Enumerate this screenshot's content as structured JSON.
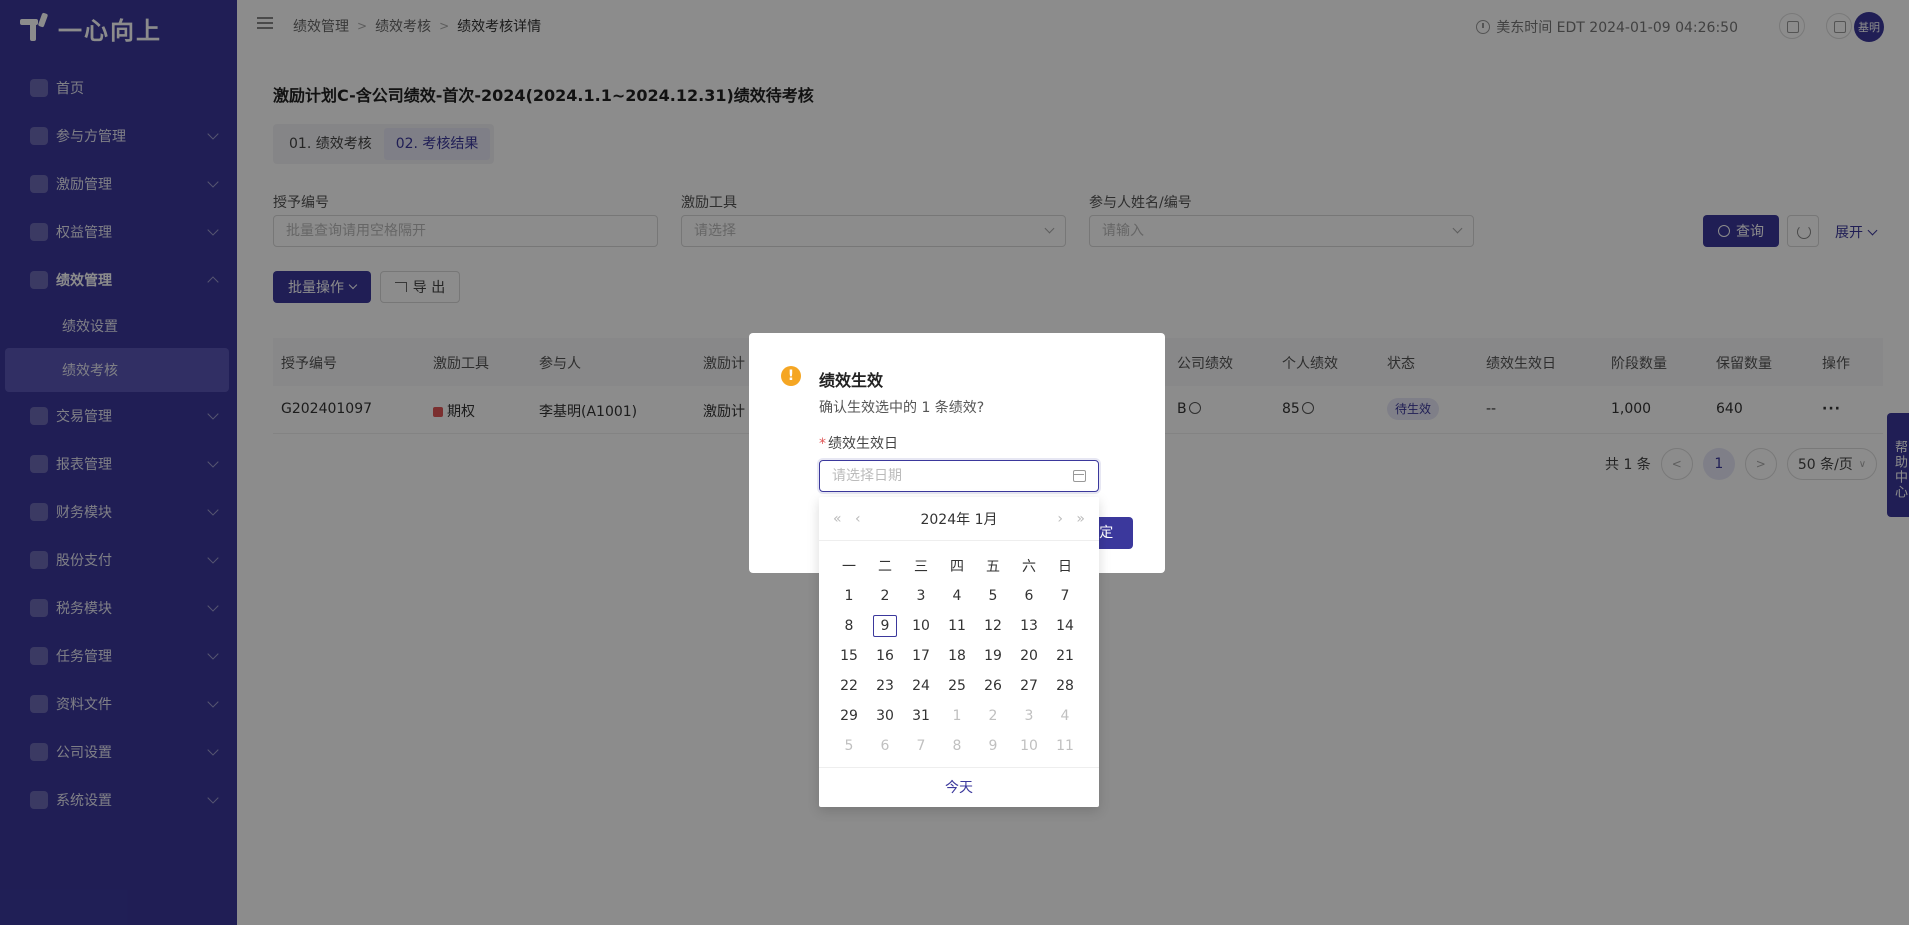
{
  "app": {
    "logo_text": "一心向上"
  },
  "sidebar": {
    "items": [
      {
        "label": "首页",
        "icon": "home-icon",
        "expandable": false
      },
      {
        "label": "参与方管理",
        "icon": "users-icon",
        "expandable": true
      },
      {
        "label": "激励管理",
        "icon": "incentive-icon",
        "expandable": true
      },
      {
        "label": "权益管理",
        "icon": "equity-icon",
        "expandable": true
      },
      {
        "label": "绩效管理",
        "icon": "performance-icon",
        "expandable": true,
        "open": true
      },
      {
        "label": "交易管理",
        "icon": "trade-icon",
        "expandable": true
      },
      {
        "label": "报表管理",
        "icon": "report-icon",
        "expandable": true
      },
      {
        "label": "财务模块",
        "icon": "finance-icon",
        "expandable": true
      },
      {
        "label": "股份支付",
        "icon": "share-payment-icon",
        "expandable": true
      },
      {
        "label": "税务模块",
        "icon": "tax-icon",
        "expandable": true
      },
      {
        "label": "任务管理",
        "icon": "task-icon",
        "expandable": true
      },
      {
        "label": "资料文件",
        "icon": "file-icon",
        "expandable": true
      },
      {
        "label": "公司设置",
        "icon": "company-icon",
        "expandable": true
      },
      {
        "label": "系统设置",
        "icon": "settings-icon",
        "expandable": true
      }
    ],
    "submenu": [
      {
        "label": "绩效设置",
        "active": false
      },
      {
        "label": "绩效考核",
        "active": true
      }
    ]
  },
  "header": {
    "breadcrumb": [
      "绩效管理",
      "绩效考核",
      "绩效考核详情"
    ],
    "time": "美东时间 EDT 2024-01-09 04:26:50",
    "avatar_text": "基明"
  },
  "main": {
    "title": "激励计划C-含公司绩效-首次-2024(2024.1.1~2024.12.31)绩效待考核",
    "tabs": [
      "01. 绩效考核",
      "02. 考核结果"
    ],
    "active_tab": 1,
    "filters": [
      {
        "label": "授予编号",
        "placeholder": "批量查询请用空格隔开",
        "type": "text"
      },
      {
        "label": "激励工具",
        "placeholder": "请选择",
        "type": "select"
      },
      {
        "label": "参与人姓名/编号",
        "placeholder": "请输入",
        "type": "select"
      }
    ],
    "query_label": "查询",
    "expand_label": "展开",
    "batch_label": "批量操作",
    "export_label": "导 出"
  },
  "table": {
    "columns": [
      "授予编号",
      "激励工具",
      "参与人",
      "激励计",
      "公司绩效",
      "个人绩效",
      "状态",
      "绩效生效日",
      "阶段数量",
      "保留数量",
      "操作"
    ],
    "rows": [
      {
        "grant_no": "G202401097",
        "tool": "期权",
        "participant": "李基明(A1001)",
        "plan": "激励计",
        "company_perf": "B",
        "personal_perf": "85",
        "status": "待生效",
        "effective_date": "--",
        "stage_qty": "1,000",
        "retained_qty": "640",
        "action": "···"
      }
    ]
  },
  "pagination": {
    "total": "共 1 条",
    "current": "1",
    "page_size": "50 条/页"
  },
  "help": {
    "label": "帮助中心"
  },
  "modal": {
    "title": "绩效生效",
    "message": "确认生效选中的 1 条绩效?",
    "field_label": "绩效生效日",
    "date_placeholder": "请选择日期",
    "confirm_label": "确 定"
  },
  "datepicker": {
    "year_label": "2024年",
    "month_label": "1月",
    "weekdays": [
      "一",
      "二",
      "三",
      "四",
      "五",
      "六",
      "日"
    ],
    "weeks": [
      [
        {
          "d": "1"
        },
        {
          "d": "2"
        },
        {
          "d": "3"
        },
        {
          "d": "4"
        },
        {
          "d": "5"
        },
        {
          "d": "6"
        },
        {
          "d": "7"
        }
      ],
      [
        {
          "d": "8"
        },
        {
          "d": "9",
          "today": true
        },
        {
          "d": "10"
        },
        {
          "d": "11"
        },
        {
          "d": "12"
        },
        {
          "d": "13"
        },
        {
          "d": "14"
        }
      ],
      [
        {
          "d": "15"
        },
        {
          "d": "16"
        },
        {
          "d": "17"
        },
        {
          "d": "18"
        },
        {
          "d": "19"
        },
        {
          "d": "20"
        },
        {
          "d": "21"
        }
      ],
      [
        {
          "d": "22"
        },
        {
          "d": "23"
        },
        {
          "d": "24"
        },
        {
          "d": "25"
        },
        {
          "d": "26"
        },
        {
          "d": "27"
        },
        {
          "d": "28"
        }
      ],
      [
        {
          "d": "29"
        },
        {
          "d": "30"
        },
        {
          "d": "31"
        },
        {
          "d": "1",
          "out": true
        },
        {
          "d": "2",
          "out": true
        },
        {
          "d": "3",
          "out": true
        },
        {
          "d": "4",
          "out": true
        }
      ],
      [
        {
          "d": "5",
          "out": true
        },
        {
          "d": "6",
          "out": true
        },
        {
          "d": "7",
          "out": true
        },
        {
          "d": "8",
          "out": true
        },
        {
          "d": "9",
          "out": true
        },
        {
          "d": "10",
          "out": true
        },
        {
          "d": "11",
          "out": true
        }
      ]
    ],
    "today_label": "今天"
  },
  "colors": {
    "primary": "#3b389c",
    "warning": "#f5a623",
    "danger": "#e05656"
  }
}
